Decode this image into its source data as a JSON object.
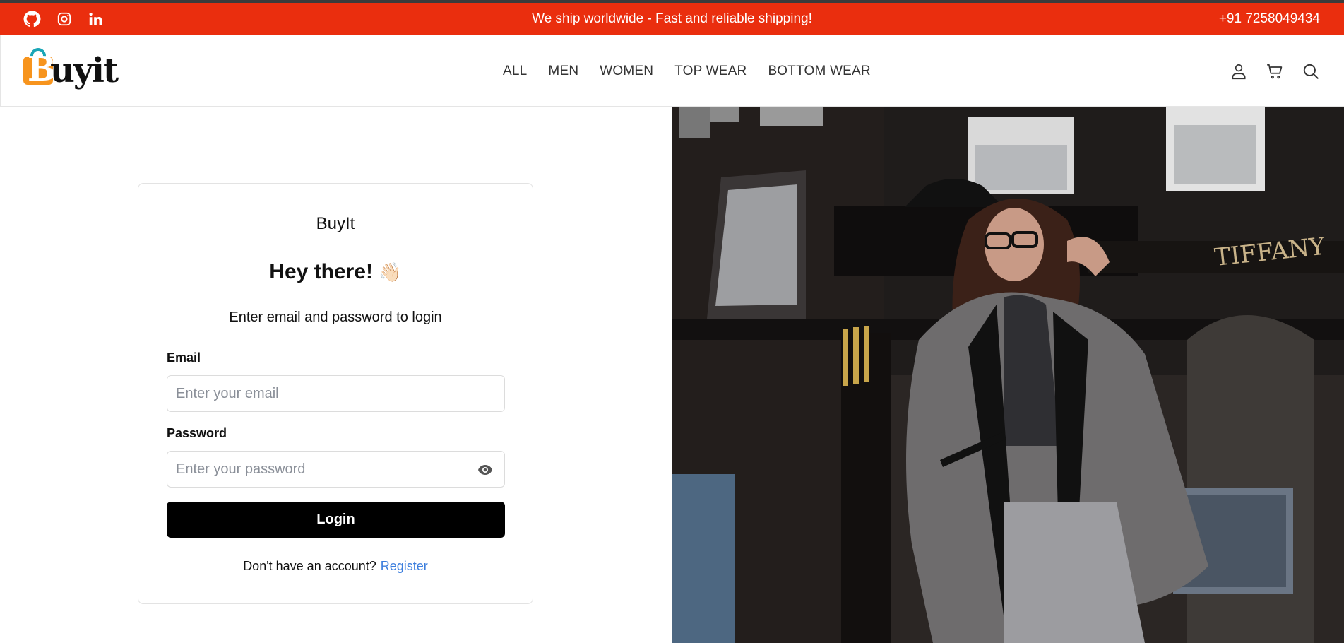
{
  "announcement": {
    "message": "We ship worldwide - Fast and reliable shipping!",
    "phone": "+91 7258049434"
  },
  "brand": {
    "logo_text_first": "B",
    "logo_text_rest": "uyit"
  },
  "nav": {
    "items": [
      {
        "label": "ALL"
      },
      {
        "label": "MEN"
      },
      {
        "label": "WOMEN"
      },
      {
        "label": "TOP WEAR"
      },
      {
        "label": "BOTTOM WEAR"
      }
    ]
  },
  "login": {
    "brand": "BuyIt",
    "heading": "Hey there!",
    "wave_emoji": "👋🏻",
    "subtitle": "Enter email and password to login",
    "email_label": "Email",
    "email_placeholder": "Enter your email",
    "email_value": "",
    "password_label": "Password",
    "password_placeholder": "Enter your password",
    "password_value": "",
    "button": "Login",
    "footer_text": "Don't have an account?",
    "register_link": "Register"
  },
  "hero": {
    "sign_text": "TIFFANY"
  },
  "icons": [
    "github-icon",
    "instagram-icon",
    "linkedin-icon",
    "user-icon",
    "cart-icon",
    "search-icon",
    "eye-icon"
  ],
  "colors": {
    "announcement_bg": "#ea2e0e",
    "login_button_bg": "#000000",
    "link": "#3b7ddd",
    "logo_bag": "#f7941d",
    "logo_handle": "#1aa6b7"
  }
}
